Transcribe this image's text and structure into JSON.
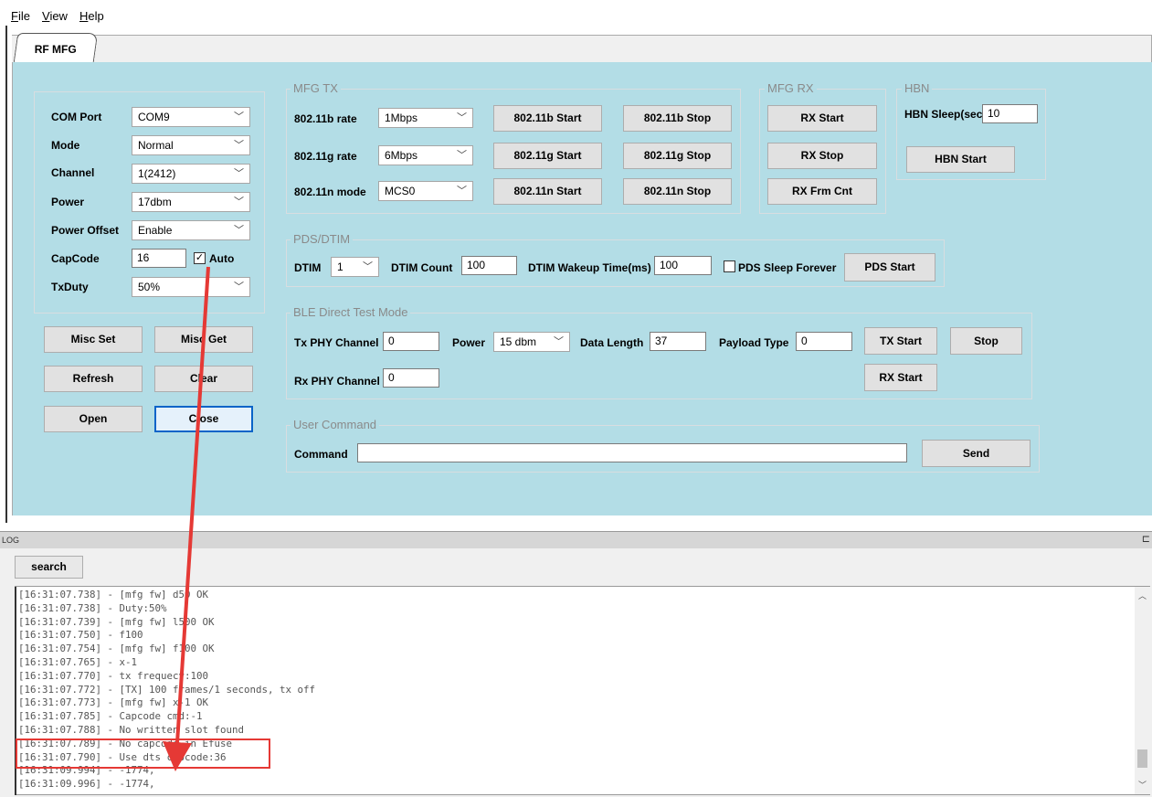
{
  "menu": [
    {
      "underline": "F",
      "rest": "ile"
    },
    {
      "underline": "V",
      "rest": "iew"
    },
    {
      "underline": "H",
      "rest": "elp"
    }
  ],
  "tab": {
    "label": "RF MFG"
  },
  "config": {
    "com_port": {
      "label": "COM Port",
      "value": "COM9"
    },
    "mode": {
      "label": "Mode",
      "value": "Normal"
    },
    "channel": {
      "label": "Channel",
      "value": "1(2412)"
    },
    "power": {
      "label": "Power",
      "value": "17dbm"
    },
    "power_offset": {
      "label": "Power Offset",
      "value": "Enable"
    },
    "capcode": {
      "label": "CapCode",
      "value": "16",
      "auto_label": "Auto",
      "auto_checked": true
    },
    "txduty": {
      "label": "TxDuty",
      "value": "50%"
    }
  },
  "left_buttons": {
    "misc_set": "Misc Set",
    "misc_get": "Misc Get",
    "refresh": "Refresh",
    "clear": "Clear",
    "open": "Open",
    "close": "Close"
  },
  "mfg_tx": {
    "title": "MFG TX",
    "rows": [
      {
        "label": "802.11b rate",
        "value": "1Mbps",
        "start": "802.11b Start",
        "stop": "802.11b Stop"
      },
      {
        "label": "802.11g rate",
        "value": "6Mbps",
        "start": "802.11g Start",
        "stop": "802.11g Stop"
      },
      {
        "label": "802.11n mode",
        "value": "MCS0",
        "start": "802.11n Start",
        "stop": "802.11n Stop"
      }
    ]
  },
  "mfg_rx": {
    "title": "MFG RX",
    "rx_start": "RX Start",
    "rx_stop": "RX Stop",
    "rx_frm_cnt": "RX Frm Cnt"
  },
  "hbn": {
    "title": "HBN",
    "sleep_label": "HBN Sleep(sec)",
    "sleep_value": "10",
    "start": "HBN Start"
  },
  "pds": {
    "title": "PDS/DTIM",
    "dtim_label": "DTIM",
    "dtim_value": "1",
    "dtim_count_label": "DTIM Count",
    "dtim_count_value": "100",
    "wakeup_label": "DTIM Wakeup Time(ms)",
    "wakeup_value": "100",
    "sleep_forever_label": "PDS Sleep Forever",
    "sleep_forever_checked": false,
    "start": "PDS Start"
  },
  "ble": {
    "title": "BLE Direct Test Mode",
    "tx_phy_label": "Tx PHY Channel",
    "tx_phy_value": "0",
    "power_label": "Power",
    "power_value": "15 dbm",
    "data_length_label": "Data Length",
    "data_length_value": "37",
    "payload_label": "Payload Type",
    "payload_value": "0",
    "tx_start": "TX Start",
    "stop": "Stop",
    "rx_phy_label": "Rx PHY Channel",
    "rx_phy_value": "0",
    "rx_start": "RX Start"
  },
  "user_command": {
    "title": "User Command",
    "label": "Command",
    "value": "",
    "send": "Send"
  },
  "log": {
    "header": "LOG",
    "close_glyph": "⊏",
    "search": "search",
    "lines": [
      "[16:31:07.738] - [mfg fw] d50 OK",
      "[16:31:07.738] - Duty:50%",
      "[16:31:07.739] - [mfg fw] l500 OK",
      "[16:31:07.750] - f100",
      "[16:31:07.754] - [mfg fw] f100 OK",
      "[16:31:07.765] - x-1",
      "[16:31:07.770] - tx frequecy:100",
      "[16:31:07.772] - [TX] 100 frames/1 seconds, tx off",
      "[16:31:07.773] - [mfg fw] x-1 OK",
      "[16:31:07.785] - Capcode cmd:-1",
      "[16:31:07.788] - No written slot found",
      "[16:31:07.789] - No capcode in Efuse",
      "[16:31:07.790] - Use dts capcode:36",
      "[16:31:09.994] - -1774,",
      "[16:31:09.996] - -1774,"
    ]
  },
  "colors": {
    "panel": "#b3dde6",
    "annotation": "#e53935",
    "focus": "#0a64c8"
  }
}
